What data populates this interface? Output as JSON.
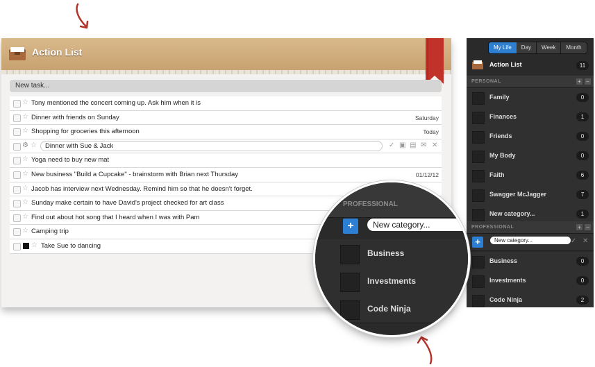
{
  "header": {
    "title": "Action List"
  },
  "new_task": {
    "placeholder": "New task..."
  },
  "tasks": [
    {
      "text": "Tony mentioned the concert coming up. Ask him when it is",
      "date": ""
    },
    {
      "text": "Dinner with friends on Sunday",
      "date": "Saturday"
    },
    {
      "text": "Shopping for groceries this afternoon",
      "date": "Today"
    },
    {
      "text": "Dinner with Sue & Jack",
      "date": "",
      "editing": true
    },
    {
      "text": "Yoga need to buy new mat",
      "date": ""
    },
    {
      "text": "New business \"Build a Cupcake\" - brainstorm with Brian next Thursday",
      "date": "01/12/12"
    },
    {
      "text": "Jacob has interview next Wednesday. Remind him so that he doesn't forget.",
      "date": ""
    },
    {
      "text": "Sunday make certain to have David's project checked for art class",
      "date": ""
    },
    {
      "text": "Find out about hot song that I heard when I was with Pam",
      "date": ""
    },
    {
      "text": "Camping trip",
      "date": ""
    },
    {
      "text": "Take Sue to dancing",
      "date": "",
      "color": "#111111"
    }
  ],
  "sidebar": {
    "view_tabs": [
      "My Life",
      "Day",
      "Week",
      "Month"
    ],
    "active_tab": "My Life",
    "action_list": {
      "label": "Action List",
      "count": "11"
    },
    "personal_header": "PERSONAL",
    "personal": [
      {
        "label": "Family",
        "count": "0"
      },
      {
        "label": "Finances",
        "count": "1"
      },
      {
        "label": "Friends",
        "count": "0"
      },
      {
        "label": "My Body",
        "count": "0"
      },
      {
        "label": "Faith",
        "count": "6"
      },
      {
        "label": "Swagger McJagger",
        "count": "7",
        "photo": true
      },
      {
        "label": "New category...",
        "count": "1"
      }
    ],
    "professional_header": "PROFESSIONAL",
    "new_category_input": "New category...",
    "professional": [
      {
        "label": "Business",
        "count": "0"
      },
      {
        "label": "Investments",
        "count": "0"
      },
      {
        "label": "Code Ninja",
        "count": "2",
        "photo": true
      }
    ]
  },
  "zoom": {
    "section": "PROFESSIONAL",
    "input": "New category...",
    "items": [
      "Business",
      "Investments",
      "Code Ninja"
    ]
  },
  "colors": {
    "accent": "#2d7fd4",
    "header": "#c8a271",
    "ribbon": "#c0322a"
  },
  "icons": {
    "check": "✓",
    "close": "✕",
    "star": "☆",
    "gear": "⚙",
    "plus": "+"
  }
}
